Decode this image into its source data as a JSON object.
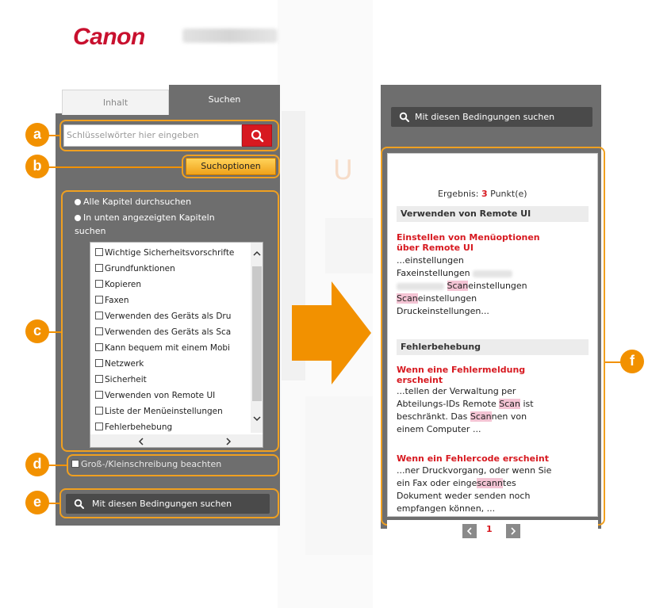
{
  "header": {
    "brand": "Canon"
  },
  "tabs": [
    {
      "label": "Inhalt"
    },
    {
      "label": "Suchen"
    }
  ],
  "search": {
    "placeholder": "Schlüsselwörter hier eingeben"
  },
  "options_label": "Suchoptionen",
  "scope": {
    "all_label": "Alle Kapitel durchsuchen",
    "selected_label": "In unten angezeigten Kapiteln suchen"
  },
  "chapters": [
    "Wichtige Sicherheitsvorschrifte",
    "Grundfunktionen",
    "Kopieren",
    "Faxen",
    "Verwenden des Geräts als Dru",
    "Verwenden des Geräts als Sca",
    "Kann bequem mit einem Mobi",
    "Netzwerk",
    "Sicherheit",
    "Verwenden von Remote UI",
    "Liste der Menüeinstellungen",
    "Fehlerbehebung"
  ],
  "case_label": "Groß-/Kleinschreibung beachten",
  "submit_label": "Mit diesen Bedingungen suchen",
  "badges": {
    "a": "a",
    "b": "b",
    "c": "c",
    "d": "d",
    "e": "e",
    "f": "f"
  },
  "results": {
    "summary_prefix": "Ergebnis: ",
    "count": "3",
    "summary_suffix": " Punkt(e)",
    "groups": [
      {
        "heading": "Verwenden von Remote UI",
        "items": [
          {
            "title_line1": "Einstellen von Menüoptionen",
            "title_line2": "über Remote UI",
            "lines": [
              "...einstellungen",
              "Faxeinstellungen",
              "Scan",
              "einstellungen",
              "Scan",
              "einstellungen",
              "Druckeinstellungen..."
            ]
          }
        ]
      },
      {
        "heading": "Fehlerbehebung",
        "items": [
          {
            "title_line1": "Wenn eine Fehlermeldung",
            "title_line2": "erscheint",
            "lines": [
              "...tellen der Verwaltung per",
              "Abteilungs-IDs",
              "Remote ",
              "Scan",
              " ist",
              "beschränkt.",
              "Das ",
              "Scan",
              "nen von",
              "einem Computer ..."
            ]
          },
          {
            "title_line1": "Wenn ein Fehlercode erscheint",
            "lines": [
              "...ner Druckvorgang, oder wenn Sie",
              "ein Fax oder einge",
              "scann",
              "tes",
              "Dokument weder senden noch",
              "empfangen können, ..."
            ]
          }
        ]
      }
    ],
    "page": "1"
  },
  "icons": {
    "search": "magnifier-icon",
    "arrow": "right-arrow-icon",
    "prev": "chevron-left-icon",
    "next": "chevron-right-icon"
  },
  "colors": {
    "accent": "#f29100",
    "brand_red": "#c8102e",
    "panel": "#6e6e6e"
  }
}
